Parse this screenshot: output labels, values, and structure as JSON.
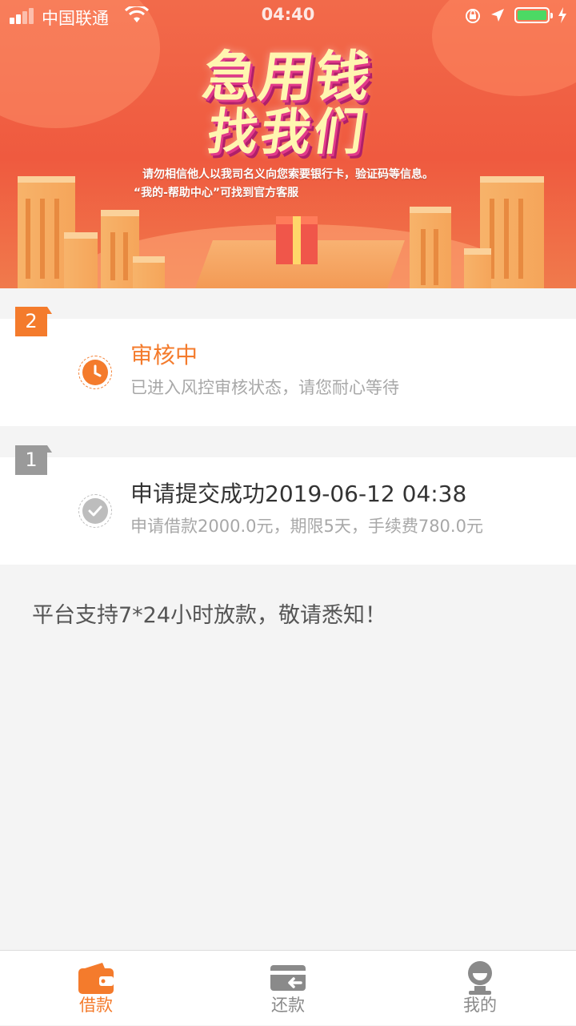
{
  "status_bar": {
    "carrier": "中国联通",
    "time": "04:40"
  },
  "banner": {
    "headline_line1": "急用钱",
    "headline_line2": "找我们",
    "notice_line1": "请勿相信他人以我司名义向您索要银行卡，验证码等信息。",
    "notice_line2": "“我的-帮助中心”可找到官方客服"
  },
  "steps": [
    {
      "number": "2",
      "title": "审核中",
      "subtitle": "已进入风控审核状态，请您耐心等待",
      "state": "active",
      "color": "#f47b2c"
    },
    {
      "number": "1",
      "title": "申请提交成功2019-06-12 04:38",
      "subtitle": "申请借款2000.0元，期限5天，手续费780.0元",
      "state": "done",
      "color": "#9a9a9a"
    }
  ],
  "notice": "平台支持7*24小时放款，敬请悉知！",
  "tabbar": {
    "tabs": [
      {
        "label": "借款",
        "icon": "wallet-icon",
        "active": true
      },
      {
        "label": "还款",
        "icon": "repay-card-icon",
        "active": false
      },
      {
        "label": "我的",
        "icon": "profile-icon",
        "active": false
      }
    ],
    "active_color": "#f47b2c",
    "inactive_color": "#8a8a8a"
  }
}
